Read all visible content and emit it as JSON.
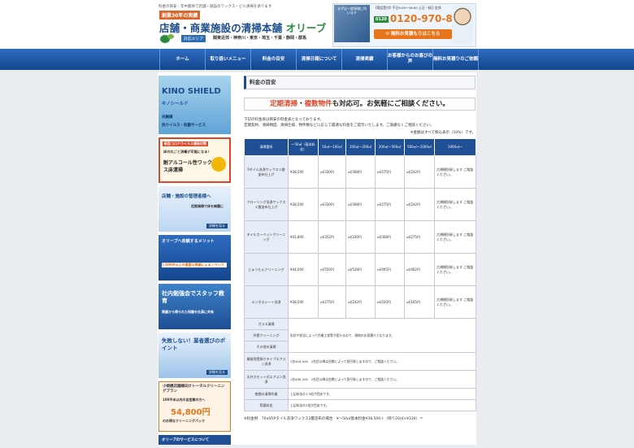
{
  "header": {
    "tagline": "料金の目安｜年中無休で店舗・施設のワックス・ビル清掃を承ります",
    "founded": "創業30年の実績",
    "title_main": "店舗・商業施設の清掃本舗 ",
    "title_accent": "オリーブ",
    "area_badge": "対応エリア",
    "area_list": "関東近郊・神奈川・東京・埼玉・千葉・静岡・群馬",
    "contact_note": "まずは一度現場に伺います",
    "hours": "【電話受付】平日9:00～18:00 土日・祝日 定休",
    "free_dial_label": "0120",
    "phone": "0120-970-886",
    "quote_button": "無料お見積もりはこちら"
  },
  "nav": [
    "ホーム",
    "取り扱いメニュー",
    "料金の目安",
    "清掃日報について",
    "清掃実績",
    "お客様からのお喜びの声",
    "無料お見積りのご依頼"
  ],
  "sidebar": {
    "kino_title": "KINO SHIELD",
    "kino_sub": "キノシールド",
    "kino_caption1": "光触媒",
    "kino_caption2": "抗ウイルス・抗菌サービス",
    "alcohol_head": "新型コロナウイルス感染対策",
    "alcohol_mid": "床の丸ごと消毒が可能になる！",
    "alcohol_main": "耐アルコール性ワックス床清掃",
    "manager_title": "店舗・施設の管理者様へ",
    "manager_sub": "定期清掃で床を綺麗に",
    "merit_title": "オリーブへ依頼するメリット",
    "merit_sub": "7,000件以上の豊富な実績によるノウハウ",
    "staff_title": "社内勉強会でスタッフ教育",
    "staff_sub": "実績から得られた知識を社員に共有",
    "point_title": "失敗しない！業者選びのポイント",
    "plan_title": "小規模店舗様向けトータルクリーニングプラン",
    "plan_sub": "100平米以内の自営業の方へ",
    "plan_price": "54,800円",
    "plan_tail": "のお得なクリーニングパック",
    "more": "詳細を見る",
    "services_title": "オリーブのサービスについて"
  },
  "main": {
    "heading": "料金の目安",
    "callout_a": "定期清掃",
    "callout_b": "・",
    "callout_c": "複数物件",
    "callout_d": "も対応可。お気軽にご相談ください。",
    "intro1": "下記の料金表は目安の料金表となっております。",
    "intro2": "定期契約、清掃頻度、清掃仕様、物件数などに応じて最適な料金をご提示いたします。ご遠慮なくご相談ください。",
    "tax_note": "※金額はすべて税込表示（10%）です。",
    "footnote": "※料金例　70㎡のPタイル洗浄ワックス2層塗布の場合　¥～50㎡基本料金¥38,500＋（残り20㎡×¥330）＝"
  },
  "table": {
    "headers": [
      "清掃箇所",
      "～50㎡（基本料金）",
      "50㎡～100㎡",
      "100㎡～200㎡",
      "200㎡～500㎡",
      "500㎡～1000㎡",
      "1000㎡～"
    ],
    "rows": [
      {
        "service": "Pタイル洗浄ワックス２層塗布仕上げ",
        "c1": "¥38,500",
        "c2": "㎡/330円",
        "c3": "㎡/308円",
        "c4": "㎡/275円",
        "c5": "㎡/242円",
        "c6": "大規模別致します ご相談ください。"
      },
      {
        "service": "フローリング洗浄ワックス２層塗布仕上げ",
        "c1": "¥38,500",
        "c2": "㎡/330円",
        "c3": "㎡/308円",
        "c4": "㎡/275円",
        "c5": "㎡/242円",
        "c6": "大規模別致します ご相談ください。"
      },
      {
        "service": "タイルカーペットクリーニング",
        "c1": "¥41,800",
        "c2": "㎡/352円",
        "c3": "㎡/330円",
        "c4": "㎡/308円",
        "c5": "㎡/275円",
        "c6": "大規模別致します ご相談ください。"
      },
      {
        "service": "じゅうたんクリーニング",
        "c1": "¥44,000",
        "c2": "㎡/550円",
        "c3": "㎡/528円",
        "c4": "㎡/495円",
        "c5": "㎡/462円",
        "c6": "大規模別致します ご相談ください。"
      },
      {
        "service": "エンボスシート洗浄",
        "c1": "¥38,500",
        "c2": "㎡/275円",
        "c3": "㎡/242円",
        "c4": "㎡/220円",
        "c5": "㎡/165円",
        "c6": "大規模別致します ご相談ください。"
      }
    ],
    "notes": [
      {
        "service": "ガラス清掃",
        "text": ""
      },
      {
        "service": "外壁クリーニング",
        "text": "形状や状況によって作業工程等が変わるので、現地のお見積りとなります。"
      },
      {
        "service": "その他の清掃",
        "text": ""
      },
      {
        "service": "業務用壁掛けタイプエアコン洗浄",
        "text": "1台¥16,500　2台目以降は台数によって割引致しますので、ご相談ください。"
      },
      {
        "service": "天井カセット式エアコン洗浄",
        "text": "1台¥36,300　2台目以降は台数によって割引致しますので、ご相談ください。"
      },
      {
        "service": "夜間の清掃作業",
        "text": "上記料金の1.5倍が目安です。"
      },
      {
        "service": "祭要料金",
        "text": "上記料金の2倍が目安です。"
      }
    ]
  },
  "colors": {
    "brand_blue": "#1b4c8c",
    "accent_orange": "#e8741b",
    "accent_green": "#2b8a3e",
    "nav_blue": "#13468e"
  }
}
